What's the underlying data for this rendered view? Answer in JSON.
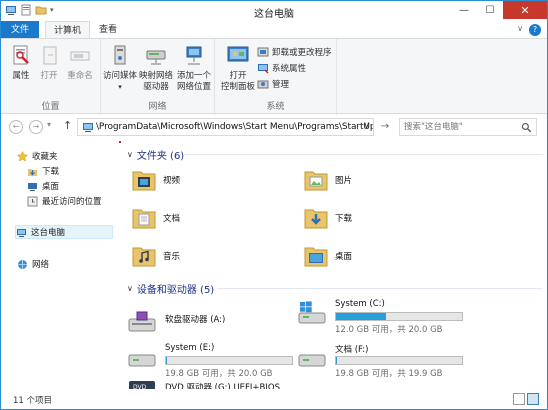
{
  "window": {
    "title": "这台电脑",
    "min": "—",
    "max": "☐",
    "close": "✕"
  },
  "tabs": {
    "file": "文件",
    "computer": "计算机",
    "view": "查看",
    "help": "?"
  },
  "ribbon": {
    "location": {
      "label": "位置",
      "properties": "属性",
      "open": "打开",
      "rename": "重命名"
    },
    "network": {
      "label": "网络",
      "access_media": "访问媒体",
      "map_drive_1": "映射网络",
      "map_drive_2": "驱动器",
      "add_location_1": "添加一个",
      "add_location_2": "网络位置"
    },
    "system": {
      "label": "系统",
      "open_cp_1": "打开",
      "open_cp_2": "控制面板",
      "uninstall": "卸载或更改程序",
      "sys_props": "系统属性",
      "manage": "管理"
    }
  },
  "address": {
    "path": "\\ProgramData\\Microsoft\\Windows\\Start Menu\\Programs\\StartUp",
    "dropdown": "∨",
    "go": "→",
    "search_placeholder": "搜索\"这台电脑\""
  },
  "nav": {
    "back": "←",
    "forward": "→",
    "recent": "▾",
    "up": "↑",
    "favorites": "收藏夹",
    "downloads": "下载",
    "desktop": "桌面",
    "recent_places": "最近访问的位置",
    "this_pc": "这台电脑",
    "network": "网络"
  },
  "folders": {
    "header": "文件夹 (6)",
    "items": [
      "视频",
      "图片",
      "文档",
      "下载",
      "音乐",
      "桌面"
    ]
  },
  "devices": {
    "header": "设备和驱动器 (5)",
    "floppy": {
      "name": "软盘驱动器 (A:)"
    },
    "system_c": {
      "name": "System (C:)",
      "size": "12.0 GB 可用，共 20.0 GB",
      "used": 0.4
    },
    "system_e": {
      "name": "System (E:)",
      "size": "19.8 GB 可用，共 20.0 GB",
      "used": 0.01
    },
    "doc_f": {
      "name": "文档 (F:)",
      "size": "19.8 GB 可用，共 19.9 GB",
      "used": 0.005
    },
    "dvd": {
      "name": "DVD 驱动器 (G:) UEFI+BIOS"
    }
  },
  "status": {
    "count": "11 个项目"
  },
  "colors": {
    "accent": "#1979ca",
    "close": "#c7382b",
    "folder": "#e9c46a",
    "bar": "#26a0da",
    "annotation": "#d42020"
  }
}
